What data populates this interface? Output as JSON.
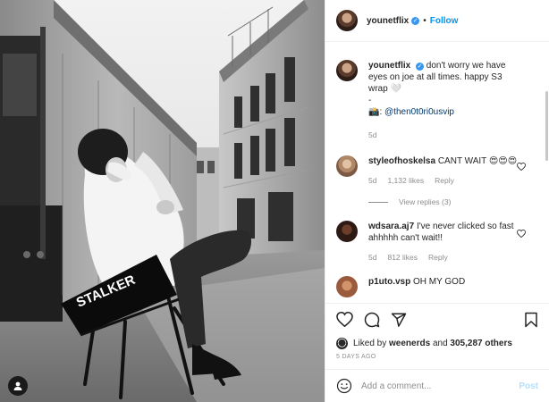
{
  "header": {
    "username": "younetflix",
    "dot": "•",
    "follow_label": "Follow"
  },
  "photo": {
    "chair_text": "STALKER"
  },
  "caption": {
    "username": "younetflix",
    "text": "don't worry we have eyes on joe at all times. happy S3 wrap 🤍",
    "dash": "-",
    "credit_prefix": "📸: ",
    "credit_mention": "@then0t0ri0usvip",
    "age": "5d"
  },
  "comments": [
    {
      "username": "styleofhoskelsa",
      "text": "CANT WAIT 😍😍😍",
      "age": "5d",
      "likes": "1,132 likes",
      "reply": "Reply",
      "view_replies": "View replies (3)"
    },
    {
      "username": "wdsara.aj7",
      "text": "I've never clicked so fast ahhhhh can't wait!!",
      "age": "5d",
      "likes": "812 likes",
      "reply": "Reply"
    },
    {
      "username": "p1uto.vsp",
      "text": "OH MY GOD"
    }
  ],
  "likes": {
    "prefix": "Liked by ",
    "user": "weenerds",
    "middle": " and ",
    "count": "305,287 others"
  },
  "timestamp": "5 DAYS AGO",
  "add_comment": {
    "placeholder": "Add a comment...",
    "post_label": "Post"
  },
  "colors": {
    "link": "#0095f6",
    "verified": "#3897f0",
    "muted": "#8e8e8e",
    "post_disabled": "#b2dffc"
  },
  "icons": [
    "verified-badge-icon",
    "heart-icon",
    "comment-icon",
    "share-icon",
    "bookmark-icon",
    "smile-icon",
    "user-tag-icon"
  ]
}
